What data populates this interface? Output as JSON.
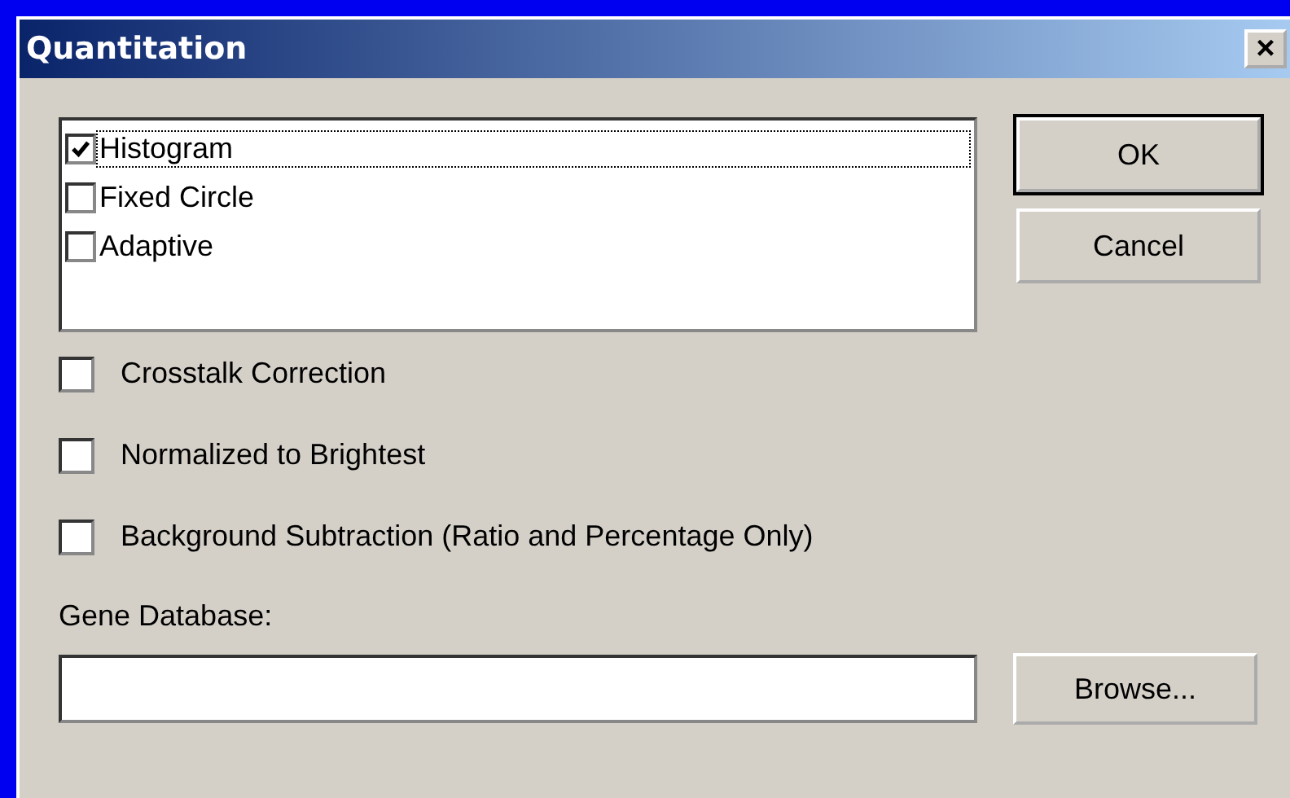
{
  "window": {
    "title": "Quantitation",
    "close": "×"
  },
  "methods": [
    {
      "label": "Histogram",
      "checked": true,
      "selected": true
    },
    {
      "label": "Fixed Circle",
      "checked": false,
      "selected": false
    },
    {
      "label": "Adaptive",
      "checked": false,
      "selected": false
    }
  ],
  "options": [
    {
      "label": "Crosstalk Correction",
      "checked": false
    },
    {
      "label": "Normalized to Brightest",
      "checked": false
    },
    {
      "label": "Background Subtraction (Ratio and Percentage Only)",
      "checked": false
    }
  ],
  "gene_database": {
    "label": "Gene Database:"
  },
  "buttons": {
    "ok": "OK",
    "cancel": "Cancel",
    "browse": "Browse..."
  }
}
